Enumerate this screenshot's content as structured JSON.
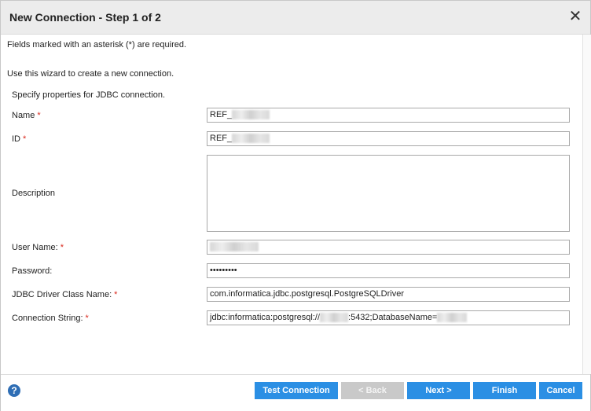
{
  "dialog": {
    "title": "New Connection - Step 1 of 2",
    "close_label": "✕",
    "required_note": "Fields marked with an asterisk (*) are required.",
    "wizard_note": "Use this wizard to create a new connection.",
    "section_note": "Specify properties for JDBC connection."
  },
  "form": {
    "name": {
      "label": "Name",
      "required": "*",
      "value": "REF_"
    },
    "id": {
      "label": "ID",
      "required": "*",
      "value": "REF_"
    },
    "description": {
      "label": "Description",
      "value": ""
    },
    "username": {
      "label": "User Name:",
      "required": "*",
      "value": ""
    },
    "password": {
      "label": "Password:",
      "value": "•••••••••"
    },
    "driver": {
      "label": "JDBC Driver Class Name:",
      "required": "*",
      "value": "com.informatica.jdbc.postgresql.PostgreSQLDriver"
    },
    "connstr": {
      "label": "Connection String:",
      "required": "*",
      "value_prefix": "jdbc:informatica:postgresql://",
      "value_mid": ":5432;DatabaseName="
    }
  },
  "footer": {
    "help_label": "?",
    "test_connection": "Test Connection",
    "back": "< Back",
    "next": "Next >",
    "finish": "Finish",
    "cancel": "Cancel"
  },
  "colors": {
    "primary_button": "#2b8fe4",
    "disabled_button": "#c9c9c9",
    "required_asterisk": "#d9281c"
  }
}
